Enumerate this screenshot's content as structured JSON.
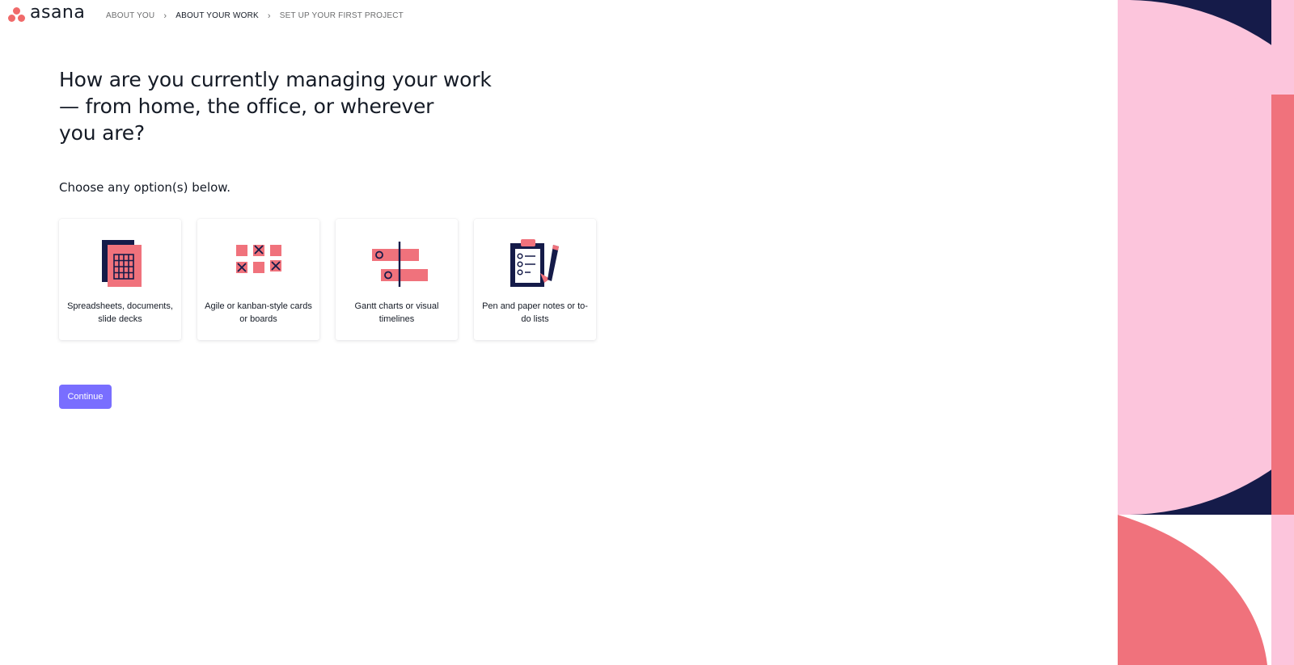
{
  "brand": {
    "name": "asana",
    "accent": "#f06a6a"
  },
  "breadcrumb": [
    {
      "label": "ABOUT YOU",
      "active": false
    },
    {
      "label": "ABOUT YOUR WORK",
      "active": true
    },
    {
      "label": "SET UP YOUR FIRST PROJECT",
      "active": false
    }
  ],
  "question": {
    "line1": "How are you currently managing your work",
    "line2": "— from home, the office, or wherever",
    "line3": "you are?"
  },
  "subtitle": "Choose any option(s) below.",
  "options": [
    {
      "label": "Spreadsheets, documents, slide decks",
      "icon": "spreadsheet-icon"
    },
    {
      "label": "Agile or kanban-style cards or boards",
      "icon": "kanban-board-icon"
    },
    {
      "label": "Gantt charts or visual timelines",
      "icon": "gantt-chart-icon"
    },
    {
      "label": "Pen and paper notes or to-do lists",
      "icon": "clipboard-pencil-icon"
    }
  ],
  "continue_label": "Continue",
  "colors": {
    "navy": "#151b49",
    "pink": "#fcc5dc",
    "coral": "#f0727c",
    "button": "#796eff"
  }
}
